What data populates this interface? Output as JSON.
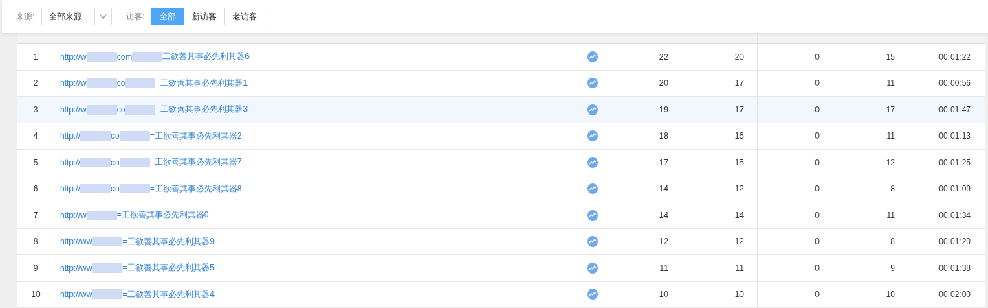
{
  "filters": {
    "source": {
      "label": "来源:",
      "value": "全部来源"
    },
    "visitor": {
      "label": "访客:",
      "options": [
        {
          "label": "全部",
          "selected": true
        },
        {
          "label": "新访客",
          "selected": false
        },
        {
          "label": "老访客",
          "selected": false
        }
      ]
    }
  },
  "table": {
    "rows": [
      {
        "rank": "1",
        "url_parts": [
          "http://w",
          "com",
          "工欲善其事必先利其器6"
        ],
        "highlighted": false,
        "values": [
          "22",
          "20",
          "0",
          "15",
          "00:01:22"
        ]
      },
      {
        "rank": "2",
        "url_parts": [
          "http://w",
          "co",
          "=工欲善其事必先利其器1"
        ],
        "highlighted": false,
        "values": [
          "20",
          "17",
          "0",
          "11",
          "00:00:56"
        ]
      },
      {
        "rank": "3",
        "url_parts": [
          "http://w",
          "co",
          "=工欲善其事必先利其器3"
        ],
        "highlighted": true,
        "values": [
          "19",
          "17",
          "0",
          "17",
          "00:01:47"
        ]
      },
      {
        "rank": "4",
        "url_parts": [
          "http://",
          "co",
          "=工欲善其事必先利其器2"
        ],
        "highlighted": false,
        "values": [
          "18",
          "16",
          "0",
          "11",
          "00:01:13"
        ]
      },
      {
        "rank": "5",
        "url_parts": [
          "http://",
          "co",
          "=工欲善其事必先利其器7"
        ],
        "highlighted": false,
        "values": [
          "17",
          "15",
          "0",
          "12",
          "00:01:25"
        ]
      },
      {
        "rank": "6",
        "url_parts": [
          "http://",
          "co",
          "=工欲善其事必先利其器8"
        ],
        "highlighted": false,
        "values": [
          "14",
          "12",
          "0",
          "8",
          "00:01:09"
        ]
      },
      {
        "rank": "7",
        "url_parts": [
          "http://w",
          "=工欲善其事必先利其器0"
        ],
        "highlighted": false,
        "values": [
          "14",
          "14",
          "0",
          "11",
          "00:01:34"
        ]
      },
      {
        "rank": "8",
        "url_parts": [
          "http://ww",
          "=工欲善其事必先利其器9"
        ],
        "highlighted": false,
        "values": [
          "12",
          "12",
          "0",
          "8",
          "00:01:20"
        ]
      },
      {
        "rank": "9",
        "url_parts": [
          "http://ww",
          "=工欲善其事必先利其器5"
        ],
        "highlighted": false,
        "values": [
          "11",
          "11",
          "0",
          "9",
          "00:01:38"
        ]
      },
      {
        "rank": "10",
        "url_parts": [
          "http://ww",
          "=工欲善其事必先利其器4"
        ],
        "highlighted": false,
        "values": [
          "10",
          "10",
          "0",
          "10",
          "00:02:00"
        ]
      }
    ]
  }
}
